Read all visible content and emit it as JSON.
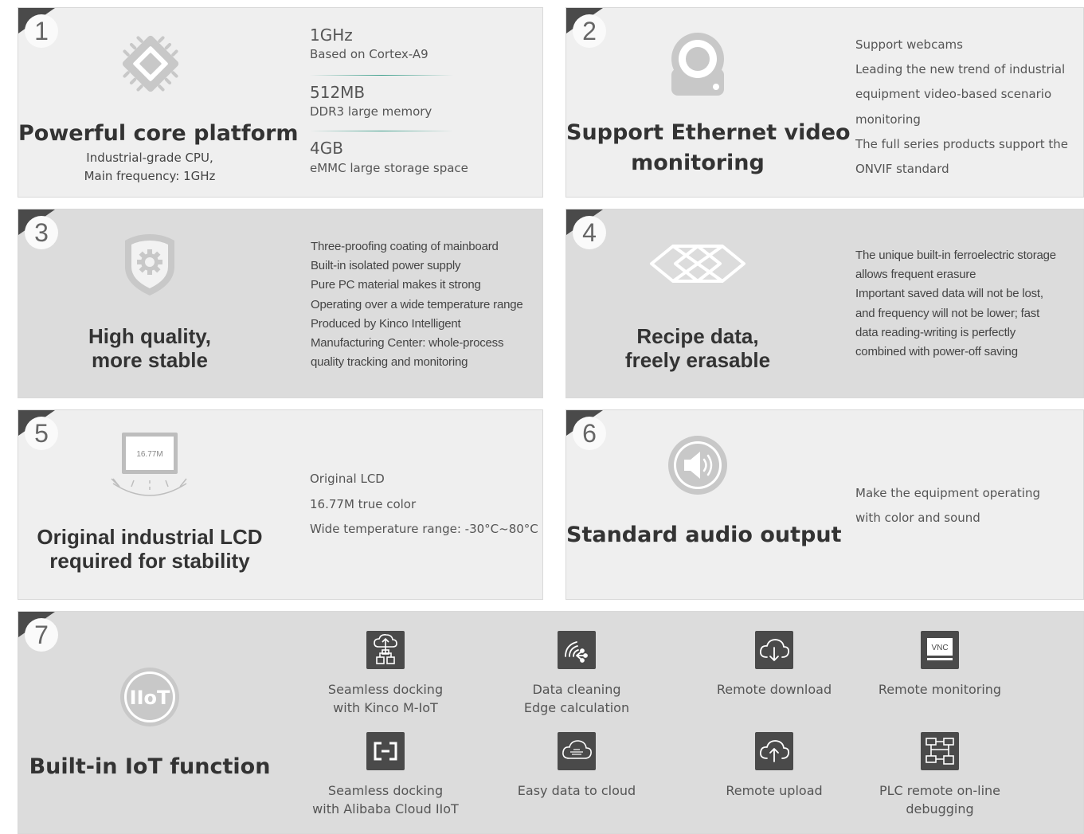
{
  "cards": [
    {
      "number": "1",
      "title": [
        "Powerful core platform"
      ],
      "subtitle": [
        "Industrial-grade CPU,",
        "Main frequency: 1GHz"
      ],
      "icon": "chip-icon",
      "specs": [
        {
          "value": "1GHz",
          "desc": "Based on Cortex-A9"
        },
        {
          "value": "512MB",
          "desc": "DDR3 large memory"
        },
        {
          "value": "4GB",
          "desc": "eMMC large storage space"
        }
      ]
    },
    {
      "number": "2",
      "title": [
        "Support Ethernet video",
        "monitoring"
      ],
      "icon": "webcam-icon",
      "points": [
        "Support webcams",
        "Leading the new trend of industrial",
        "equipment video-based scenario",
        "monitoring",
        "The full series products support the",
        "ONVIF standard"
      ]
    },
    {
      "number": "3",
      "title": [
        "High quality,",
        "more stable"
      ],
      "icon": "shield-gear-icon",
      "points": [
        "Three-proofing coating of mainboard",
        "Built-in isolated power supply",
        "Pure PC material makes it strong",
        "Operating over a wide temperature range",
        "Produced by Kinco Intelligent",
        "Manufacturing Center: whole-process",
        "quality tracking and monitoring"
      ]
    },
    {
      "number": "4",
      "title": [
        "Recipe data,",
        "freely erasable"
      ],
      "icon": "ferroelectric-chip-icon",
      "points": [
        "The unique built-in ferroelectric storage",
        "allows frequent erasure",
        "Important saved data will not be lost,",
        "and frequency will not be lower; fast",
        "data reading-writing is perfectly",
        "combined with power-off saving"
      ]
    },
    {
      "number": "5",
      "title": [
        "Original industrial LCD",
        "required for stability"
      ],
      "icon": "lcd-screen-icon",
      "icon_text": "16.77M",
      "points": [
        "Original LCD",
        "16.77M true color",
        "Wide temperature range: -30°C~80°C"
      ]
    },
    {
      "number": "6",
      "title": [
        "Standard audio output"
      ],
      "icon": "speaker-icon",
      "points": [
        "Make the equipment operating",
        "with color and sound"
      ]
    }
  ],
  "iot": {
    "number": "7",
    "badge": "IIoT",
    "title": "Built-in IoT function",
    "features": [
      {
        "icon": "cloud-network-icon",
        "lines": [
          "Seamless docking",
          "with Kinco M-IoT"
        ]
      },
      {
        "icon": "edge-signal-icon",
        "lines": [
          "Data cleaning",
          "Edge calculation"
        ]
      },
      {
        "icon": "cloud-download-icon",
        "lines": [
          "Remote download"
        ]
      },
      {
        "icon": "vnc-monitor-icon",
        "lines": [
          "Remote monitoring"
        ],
        "icon_text": "VNC"
      },
      {
        "icon": "alibaba-cloud-icon",
        "lines": [
          "Seamless docking",
          "with Alibaba Cloud IIoT"
        ]
      },
      {
        "icon": "data-cloud-icon",
        "lines": [
          "Easy data to cloud"
        ]
      },
      {
        "icon": "cloud-upload-icon",
        "lines": [
          "Remote upload"
        ]
      },
      {
        "icon": "plc-debug-icon",
        "lines": [
          "PLC remote on-line",
          "debugging"
        ]
      }
    ]
  }
}
